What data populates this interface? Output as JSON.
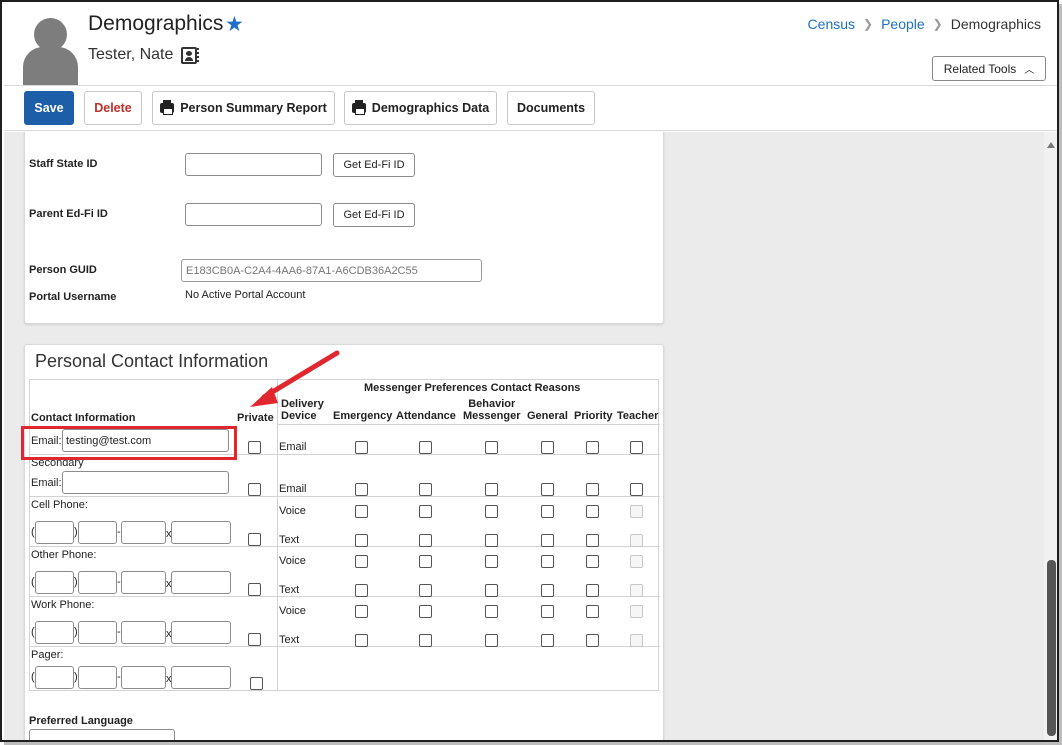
{
  "header": {
    "title": "Demographics",
    "person_name": "Tester, Nate",
    "favorite_icon": "star-icon",
    "breadcrumb": [
      "Census",
      "People",
      "Demographics"
    ],
    "related_tools": "Related Tools"
  },
  "toolbar": {
    "save": "Save",
    "delete": "Delete",
    "person_summary_report": "Person Summary Report",
    "demographics_data": "Demographics Data",
    "documents": "Documents"
  },
  "ids": {
    "staff_state_id_label": "Staff State ID",
    "parent_edfi_id_label": "Parent Ed-Fi ID",
    "get_edfi_id": "Get Ed-Fi ID",
    "person_guid_label": "Person GUID",
    "person_guid_value": "E183CB0A-C2A4-4AA6-87A1-A6CDB36A2C55",
    "portal_username_label": "Portal Username",
    "portal_username_value": "No Active Portal Account"
  },
  "contact": {
    "section_title": "Personal Contact Information",
    "header_contact_info": "Contact Information",
    "header_private": "Private",
    "header_messenger": "Messenger Preferences Contact Reasons",
    "header_delivery_1": "Delivery",
    "header_delivery_2": "Device",
    "reasons": {
      "emergency": "Emergency",
      "attendance": "Attendance",
      "behavior_1": "Behavior",
      "behavior_2": "Messenger",
      "general": "General",
      "priority": "Priority",
      "teacher": "Teacher"
    },
    "email_label": "Email:",
    "email_value": "testing@test.com",
    "secondary_label": "Secondary",
    "secondary_email_label": "Email:",
    "cell_phone_label": "Cell Phone:",
    "other_phone_label": "Other Phone:",
    "work_phone_label": "Work Phone:",
    "pager_label": "Pager:",
    "device_email": "Email",
    "device_voice": "Voice",
    "device_text": "Text",
    "phone_open_paren": "(",
    "phone_close_paren": ")",
    "phone_dash": "-",
    "phone_ext": "x",
    "preferred_language_label": "Preferred Language"
  },
  "colors": {
    "brand_blue": "#1c5fa8",
    "link_blue": "#1d6fc7",
    "delete_red": "#c0312b",
    "annotation_red": "#e0262f"
  }
}
